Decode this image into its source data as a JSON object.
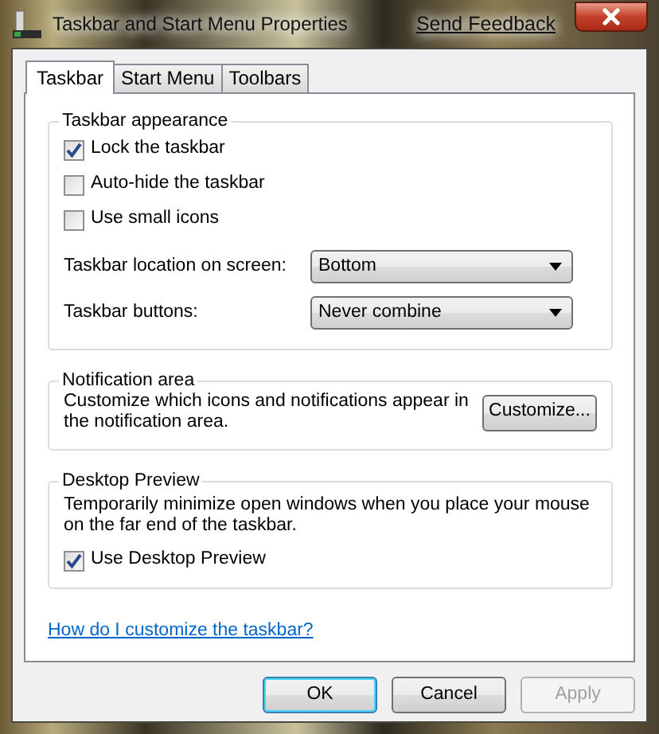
{
  "window": {
    "title": "Taskbar and Start Menu Properties",
    "feedback_link": "Send Feedback"
  },
  "tabs": [
    {
      "label": "Taskbar",
      "selected": true
    },
    {
      "label": "Start Menu",
      "selected": false
    },
    {
      "label": "Toolbars",
      "selected": false
    }
  ],
  "appearance": {
    "legend": "Taskbar appearance",
    "checkboxes": [
      {
        "label": "Lock the taskbar",
        "checked": true
      },
      {
        "label": "Auto-hide the taskbar",
        "checked": false
      },
      {
        "label": "Use small icons",
        "checked": false
      }
    ],
    "dropdowns": [
      {
        "label": "Taskbar location on screen:",
        "value": "Bottom"
      },
      {
        "label": "Taskbar buttons:",
        "value": "Never combine"
      }
    ]
  },
  "notification": {
    "legend": "Notification area",
    "description": "Customize which icons and notifications appear in the notification area.",
    "button": "Customize..."
  },
  "preview": {
    "legend": "Desktop Preview",
    "description": "Temporarily minimize open windows when you place your mouse on the far end of the taskbar.",
    "checkbox": {
      "label": "Use Desktop Preview",
      "checked": true
    }
  },
  "help_link": "How do I customize the taskbar?",
  "buttons": [
    {
      "label": "OK",
      "default": true,
      "disabled": false
    },
    {
      "label": "Cancel",
      "default": false,
      "disabled": false
    },
    {
      "label": "Apply",
      "default": false,
      "disabled": true
    }
  ]
}
